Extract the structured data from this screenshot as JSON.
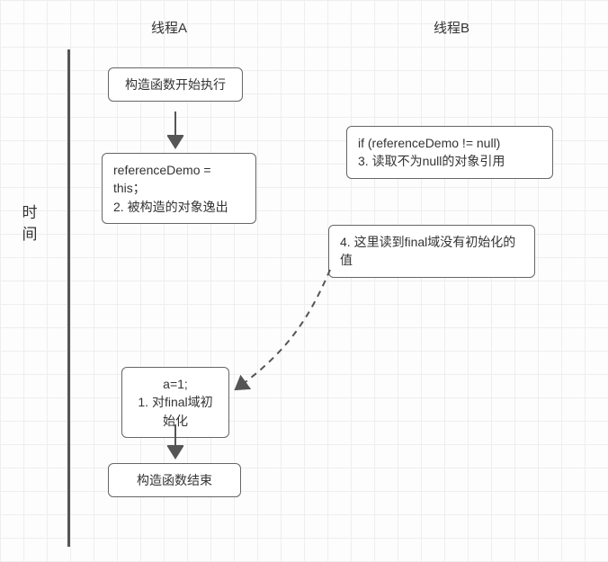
{
  "headers": {
    "threadA": "线程A",
    "threadB": "线程B",
    "time": "时\n间"
  },
  "nodes": {
    "start": "构造函数开始执行",
    "escape": "referenceDemo = this；\n2. 被构造的对象逸出",
    "nullcheck": " if (referenceDemo != null)\n3. 读取不为null的对象引用",
    "readuninit": "4. 这里读到final域没有初始化的值",
    "initfinal": "a=1;\n1. 对final域初始化",
    "end": "构造函数结束"
  }
}
